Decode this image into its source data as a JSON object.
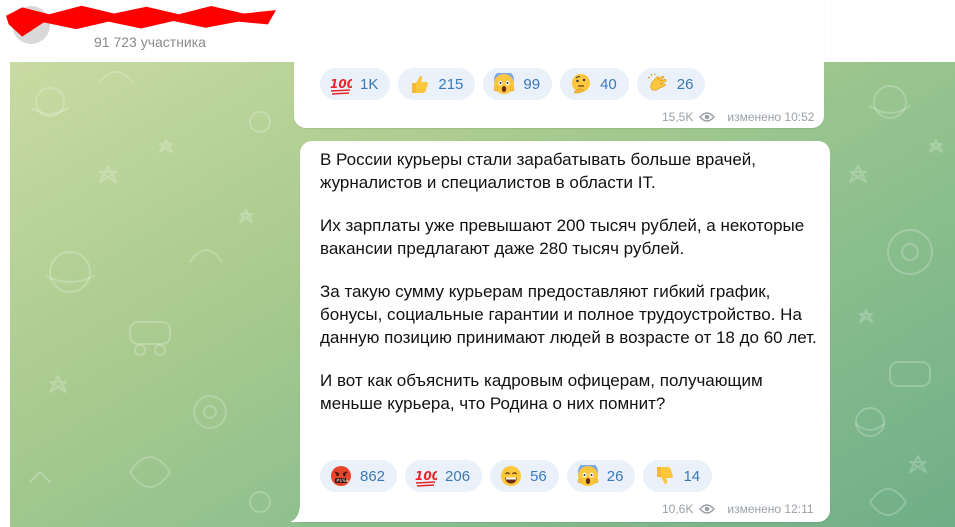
{
  "header": {
    "subscribers": "91 723 участника"
  },
  "previous_post": {
    "reactions": [
      {
        "emoji": "hundred-points",
        "count": "1K"
      },
      {
        "emoji": "thumbs-up",
        "count": "215"
      },
      {
        "emoji": "screaming-face",
        "count": "99"
      },
      {
        "emoji": "thinking-face",
        "count": "40"
      },
      {
        "emoji": "clapping-hands",
        "count": "26"
      }
    ],
    "views": "15,5K",
    "edited": "изменено 10:52"
  },
  "post": {
    "paragraphs": [
      "В России курьеры стали зарабатывать больше врачей, журналистов и специалистов в области IT.",
      "Их зарплаты уже превышают 200 тысяч рублей, а некоторые вакансии предлагают даже 280 тысяч рублей.",
      "За такую сумму курьерам предоставляют гибкий график, бонусы, социальные гарантии и полное трудоустройство. На данную позицию принимают людей в возрасте от 18 до 60 лет.",
      "И вот как объяснить кадровым офицерам, получающим меньше курьера, что Родина о них помнит?"
    ],
    "reactions": [
      {
        "emoji": "face-with-symbols-on-mouth",
        "count": "862"
      },
      {
        "emoji": "hundred-points",
        "count": "206"
      },
      {
        "emoji": "grinning-face-with-smiling-eyes",
        "count": "56"
      },
      {
        "emoji": "screaming-face",
        "count": "26"
      },
      {
        "emoji": "thumbs-down",
        "count": "14"
      }
    ],
    "views": "10,6K",
    "edited": "изменено 12:11"
  },
  "colors": {
    "accent": "#3a79b9",
    "reaction_bg": "#eaf1fa",
    "meta": "#9aa0a6"
  }
}
